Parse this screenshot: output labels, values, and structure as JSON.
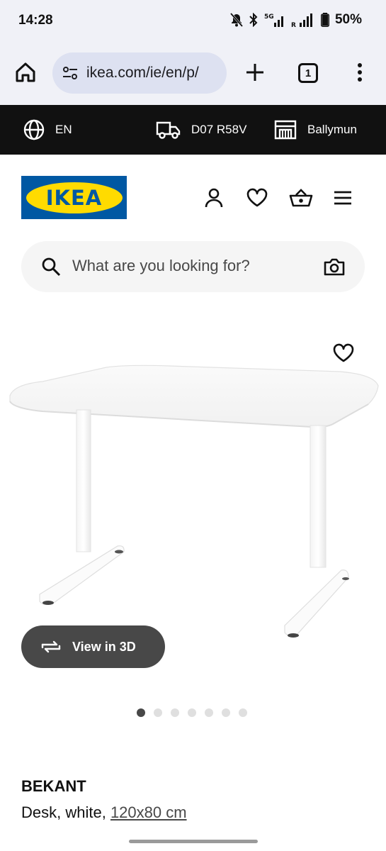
{
  "status_bar": {
    "time": "14:28",
    "network": "5G",
    "roaming": "R",
    "battery": "50%",
    "icons": [
      "mute-icon",
      "bluetooth-icon",
      "signal-5g-icon",
      "signal-icon",
      "battery-icon"
    ]
  },
  "browser": {
    "url": "ikea.com/ie/en/p/",
    "tab_count": "1",
    "icons": [
      "home-icon",
      "site-settings-icon",
      "plus-icon",
      "tabs-icon",
      "more-vert-icon"
    ]
  },
  "top_strip": {
    "language": "EN",
    "postcode": "D07 R58V",
    "store": "Ballymun",
    "icons": [
      "globe-icon",
      "truck-icon",
      "store-icon"
    ]
  },
  "header": {
    "logo_text": "IKEA",
    "icons": [
      "user-icon",
      "heart-icon",
      "basket-icon",
      "hamburger-icon"
    ]
  },
  "search": {
    "placeholder": "What are you looking for?"
  },
  "gallery": {
    "view_3d_label": "View in 3D",
    "image_count": 7,
    "active_index": 0
  },
  "product": {
    "name": "BEKANT",
    "description": "Desk, white, ",
    "size_link": "120x80 cm"
  },
  "colors": {
    "ikea_blue": "#0058a3",
    "ikea_yellow": "#ffdb00",
    "strip_bg": "#111111",
    "browser_bg": "#f0f1f7",
    "url_pill_bg": "#dde1f1"
  }
}
